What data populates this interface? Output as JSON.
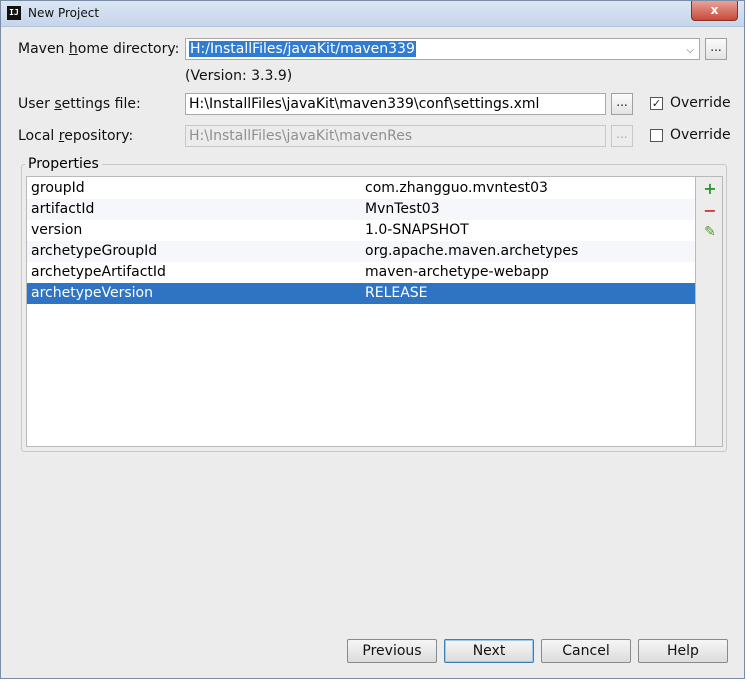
{
  "window": {
    "title": "New Project",
    "close_glyph": "x"
  },
  "maven_home": {
    "label_pre": "Maven ",
    "label_mnemonic": "h",
    "label_post": "ome directory:",
    "value": "H:/InstallFiles/javaKit/maven339",
    "version": "(Version: 3.3.9)"
  },
  "user_settings": {
    "label_pre": "User ",
    "label_mnemonic": "s",
    "label_post": "ettings file:",
    "value": "H:\\InstallFiles\\javaKit\\maven339\\conf\\settings.xml",
    "override_label": "Override",
    "override_checked": true
  },
  "local_repo": {
    "label_pre": "Local ",
    "label_mnemonic": "r",
    "label_post": "epository:",
    "value": "H:\\InstallFiles\\javaKit\\mavenRes",
    "override_label": "Override",
    "override_checked": false
  },
  "browse_label": "...",
  "properties": {
    "title": "Properties",
    "rows": [
      {
        "key": "groupId",
        "value": "com.zhangguo.mvntest03"
      },
      {
        "key": "artifactId",
        "value": "MvnTest03"
      },
      {
        "key": "version",
        "value": "1.0-SNAPSHOT"
      },
      {
        "key": "archetypeGroupId",
        "value": "org.apache.maven.archetypes"
      },
      {
        "key": "archetypeArtifactId",
        "value": "maven-archetype-webapp"
      },
      {
        "key": "archetypeVersion",
        "value": "RELEASE"
      }
    ],
    "selected_row": 5,
    "tools": {
      "add": "+",
      "remove": "−",
      "edit": "✎"
    }
  },
  "buttons": {
    "previous": "Previous",
    "next": "Next",
    "cancel": "Cancel",
    "help": "Help"
  },
  "colors": {
    "selection": "#2e74c2",
    "add": "#2e9a2e",
    "remove": "#d03a3a",
    "edit": "#4f9a2f"
  }
}
